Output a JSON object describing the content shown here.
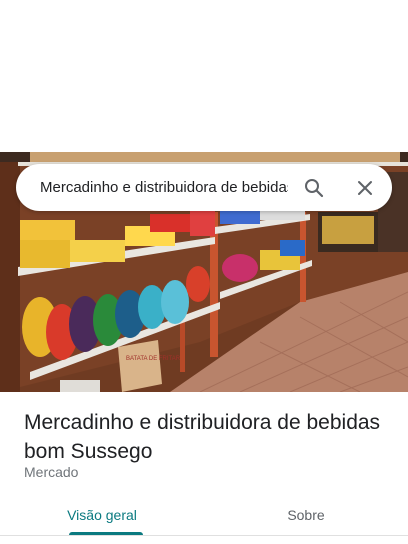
{
  "search": {
    "value": "Mercadinho e distribuidora de bebidas bom Sussego"
  },
  "place": {
    "name": "Mercadinho e distribuidora de bebidas bom Sussego",
    "category": "Mercado"
  },
  "tabs": [
    {
      "label": "Visão geral",
      "active": true
    },
    {
      "label": "Sobre",
      "active": false
    }
  ],
  "photo": {
    "sign_text": "BATATA DE FRITAR"
  },
  "colors": {
    "active_tab": "#0b7a80",
    "inactive_tab": "#5f6368"
  },
  "icons": {
    "search": "search-icon",
    "close": "close-icon"
  }
}
